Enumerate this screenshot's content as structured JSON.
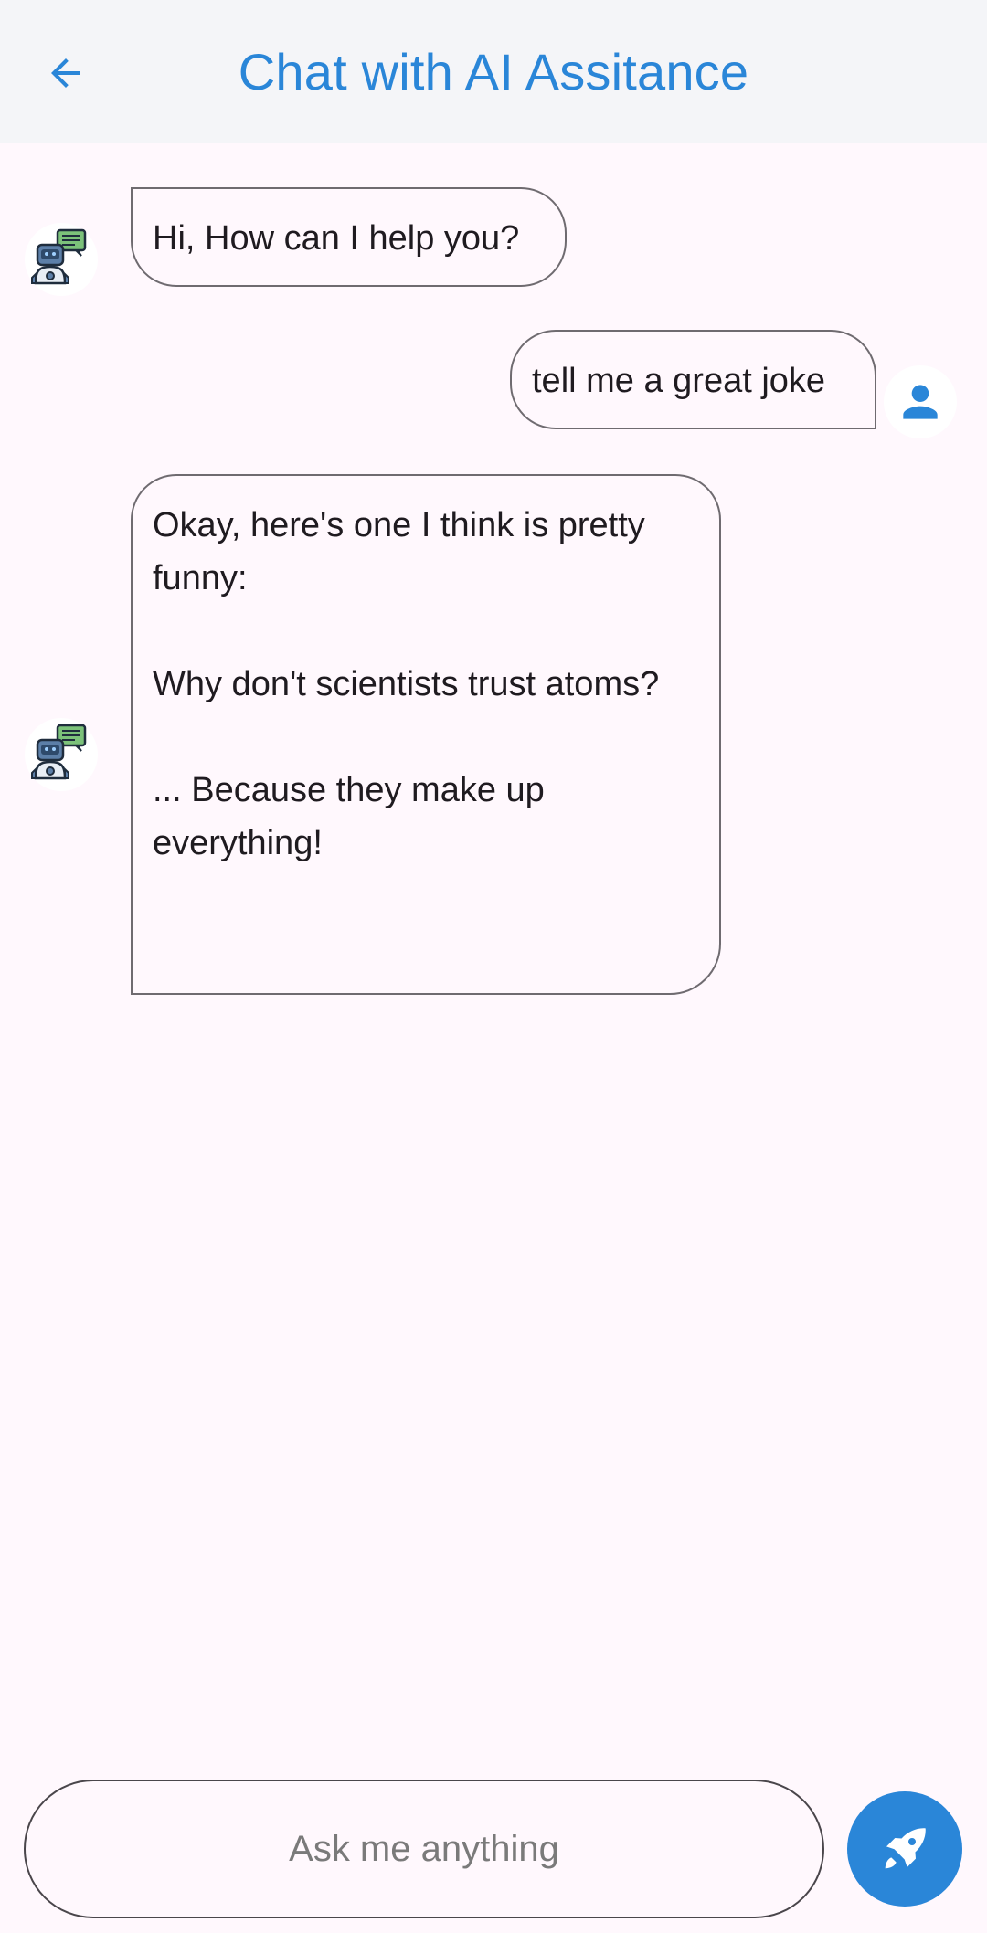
{
  "app_bar": {
    "title": "Chat with AI Assitance",
    "back_icon": "arrow-back-icon",
    "accent": "#2A86D8"
  },
  "messages": [
    {
      "sender": "bot",
      "text": "Hi, How can I help you?"
    },
    {
      "sender": "user",
      "text": "tell me a great joke"
    },
    {
      "sender": "bot",
      "text": "Okay, here's one I think is pretty funny:\n\nWhy don't scientists trust atoms?\n\n... Because they make up everything!\n"
    }
  ],
  "composer": {
    "placeholder": "Ask me anything",
    "send_icon": "rocket-icon"
  }
}
